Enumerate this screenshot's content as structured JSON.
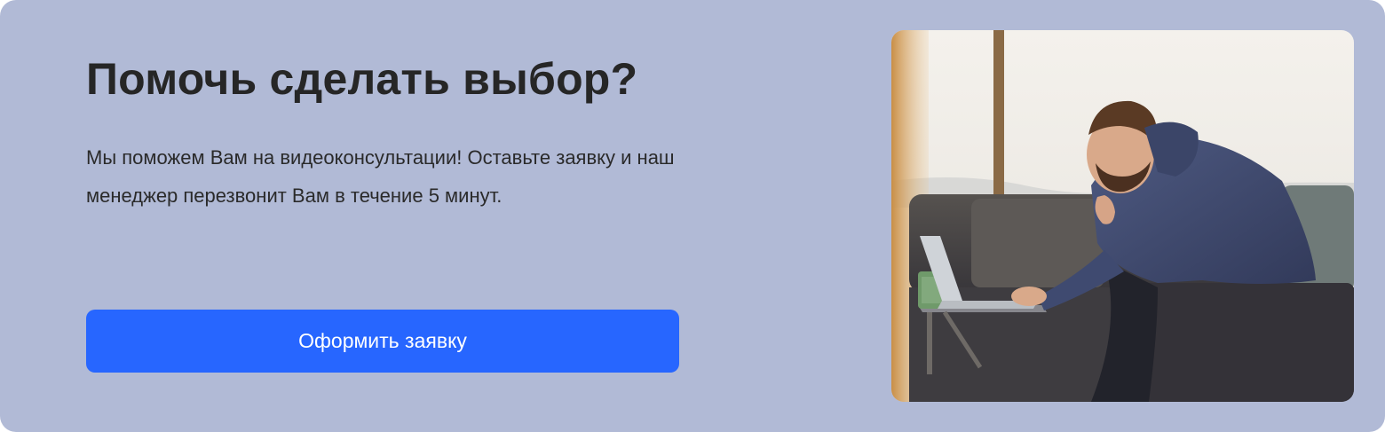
{
  "banner": {
    "title": "Помочь сделать выбор?",
    "description": "Мы поможем Вам на видеоконсультации! Оставьте заявку и наш менеджер перезвонит Вам в течение 5 минут.",
    "cta_label": "Оформить заявку",
    "photo_icon": "man-with-laptop-photo"
  },
  "colors": {
    "background": "#b1bad6",
    "button": "#2766ff",
    "title": "#262626"
  }
}
